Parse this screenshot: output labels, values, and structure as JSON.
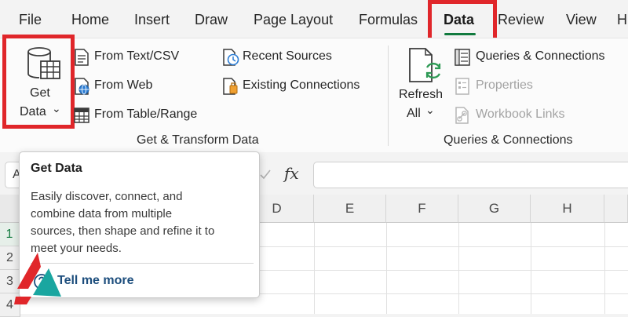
{
  "menu": {
    "tabs": [
      {
        "label": "File"
      },
      {
        "label": "Home"
      },
      {
        "label": "Insert"
      },
      {
        "label": "Draw"
      },
      {
        "label": "Page Layout"
      },
      {
        "label": "Formulas"
      },
      {
        "label": "Data"
      },
      {
        "label": "Review"
      },
      {
        "label": "View"
      },
      {
        "label": "H"
      }
    ],
    "active_tab": "Data"
  },
  "ribbon": {
    "get_transform": {
      "get_data": {
        "line1": "Get",
        "line2": "Data",
        "caret": "⌄"
      },
      "items": [
        {
          "label": "From Text/CSV",
          "icon": "text-file-icon"
        },
        {
          "label": "From Web",
          "icon": "web-icon"
        },
        {
          "label": "From Table/Range",
          "icon": "table-icon"
        },
        {
          "label": "Recent Sources",
          "icon": "recent-sources-icon"
        },
        {
          "label": "Existing Connections",
          "icon": "existing-connections-icon"
        }
      ],
      "group_label": "Get & Transform Data"
    },
    "queries": {
      "refresh": {
        "line1": "Refresh",
        "line2": "All",
        "caret": "⌄"
      },
      "items": [
        {
          "label": "Queries & Connections",
          "enabled": true
        },
        {
          "label": "Properties",
          "enabled": false
        },
        {
          "label": "Workbook Links",
          "enabled": false
        }
      ],
      "group_label": "Queries & Connections"
    }
  },
  "formula_bar": {
    "namebox": "A",
    "fx": "fx"
  },
  "sheet": {
    "columns": [
      "D",
      "E",
      "F",
      "G",
      "H"
    ],
    "rows": [
      "1",
      "2",
      "3",
      "4"
    ]
  },
  "tooltip": {
    "title": "Get Data",
    "lines": [
      "Easily discover, connect, and",
      "combine data from multiple",
      "sources, then shape and refine it to",
      "meet your needs."
    ],
    "link": "Tell me more"
  },
  "colors": {
    "highlight": "#e0262a",
    "accent": "#117a3e",
    "link": "#1d4e7d"
  }
}
